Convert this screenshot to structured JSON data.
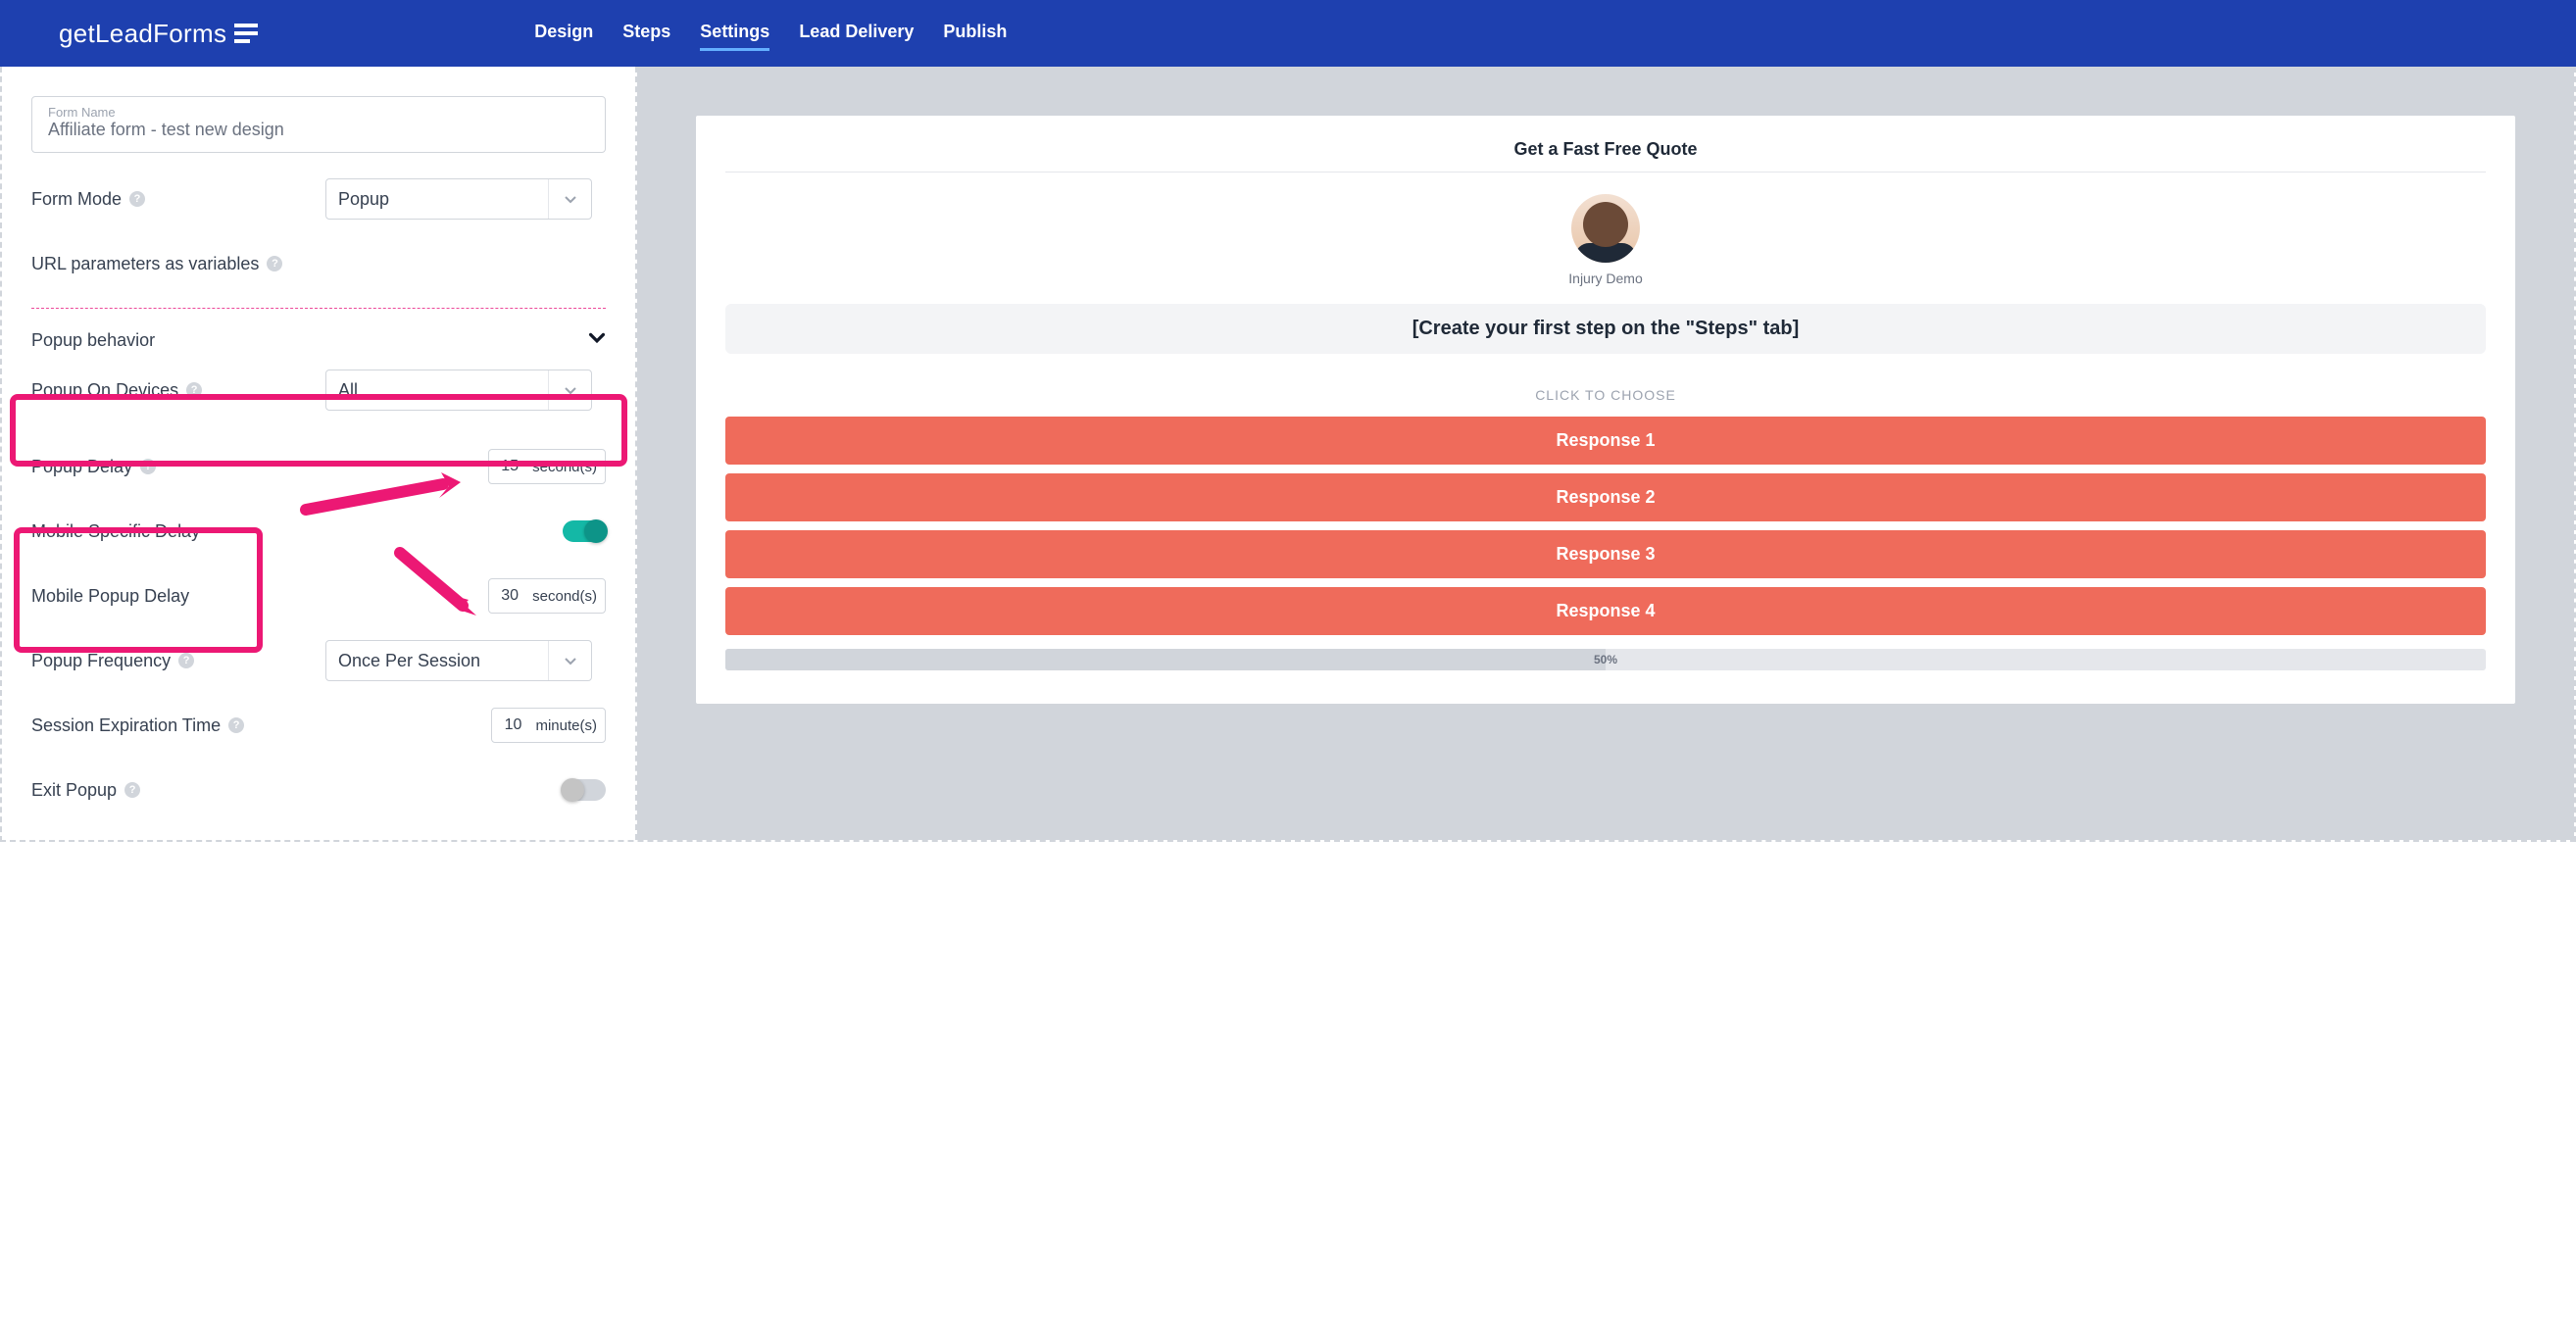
{
  "brand": {
    "name": "getLeadForms"
  },
  "nav": {
    "design": "Design",
    "steps": "Steps",
    "settings": "Settings",
    "lead_delivery": "Lead Delivery",
    "publish": "Publish"
  },
  "form_name": {
    "label": "Form Name",
    "value": "Affiliate form - test new design"
  },
  "form_mode": {
    "label": "Form Mode",
    "value": "Popup"
  },
  "url_params": {
    "label": "URL parameters as variables"
  },
  "popup_behavior": {
    "label": "Popup behavior"
  },
  "popup_devices": {
    "label": "Popup On Devices",
    "value": "All"
  },
  "popup_delay": {
    "label": "Popup Delay",
    "value": "15",
    "unit": "second(s)"
  },
  "mobile_specific": {
    "label": "Mobile Specific Delay"
  },
  "mobile_delay": {
    "label": "Mobile Popup Delay",
    "value": "30",
    "unit": "second(s)"
  },
  "popup_frequency": {
    "label": "Popup Frequency",
    "value": "Once Per Session"
  },
  "session_exp": {
    "label": "Session Expiration Time",
    "value": "10",
    "unit": "minute(s)"
  },
  "exit_popup": {
    "label": "Exit Popup"
  },
  "preview": {
    "title": "Get a Fast Free Quote",
    "subtitle": "Injury Demo",
    "banner": "[Create your first step on the \"Steps\" tab]",
    "choose": "CLICK TO CHOOSE",
    "responses": [
      "Response 1",
      "Response 2",
      "Response 3",
      "Response 4"
    ],
    "progress": "50%"
  }
}
